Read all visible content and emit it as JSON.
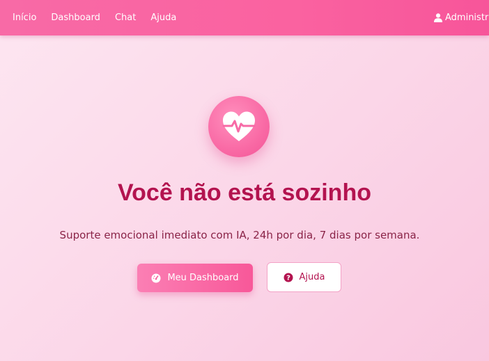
{
  "nav": {
    "links": [
      "Início",
      "Dashboard",
      "Chat",
      "Ajuda"
    ],
    "user_label": "Administra"
  },
  "hero": {
    "icon": "heart-pulse-icon",
    "title": "Você não está sozinho",
    "subtitle": "Suporte emocional imediato com IA, 24h por dia, 7 dias por semana."
  },
  "buttons": {
    "primary_label": "Meu Dashboard",
    "primary_icon": "gauge-icon",
    "secondary_label": "Ajuda",
    "secondary_icon": "question-circle-icon"
  },
  "colors": {
    "accent": "#f85899",
    "title": "#b3134f",
    "subtitle": "#8a2347"
  }
}
